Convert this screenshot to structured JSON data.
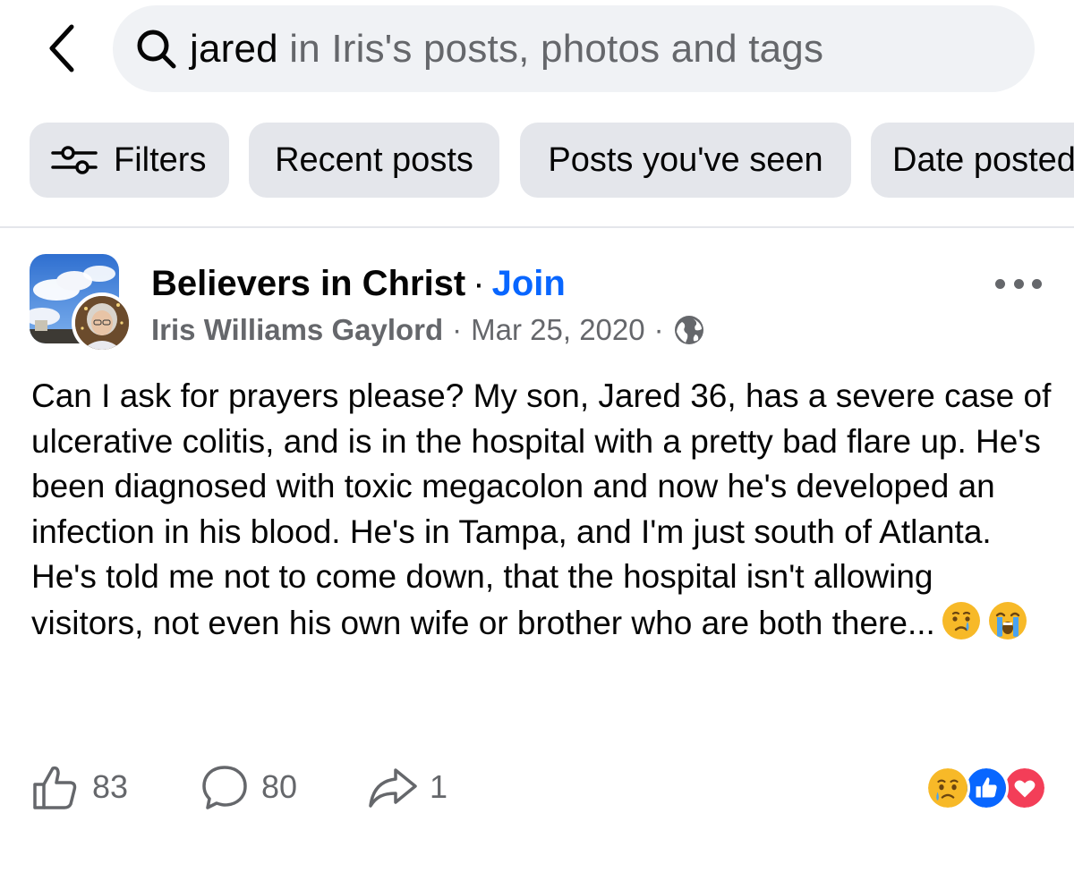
{
  "search": {
    "query": "jared",
    "scope": " in Iris's posts, photos and tags"
  },
  "chips": {
    "filters": "Filters",
    "recent": "Recent posts",
    "seen": "Posts you've seen",
    "date": "Date posted"
  },
  "post": {
    "group_name": "Believers in Christ",
    "separator": "·",
    "join_label": "Join",
    "author": "Iris Williams Gaylord",
    "date": "Mar 25, 2020",
    "privacy_icon": "globe-icon",
    "body": "Can I ask for prayers please?  My son, Jared 36, has a severe case of ulcerative colitis, and is in the hospital with a pretty bad flare up.  He's been diagnosed with toxic megacolon and now he's developed an infection in his blood.  He's in Tampa, and I'm just south of Atlanta.  He's told me not to come down, that the hospital isn't allowing visitors, not even his own wife or brother who are both there...",
    "body_emojis": [
      "crying-face-emoji",
      "loudly-crying-face-emoji"
    ],
    "likes": "83",
    "comments": "80",
    "shares": "1",
    "reactions": [
      "sad-reaction-icon",
      "like-reaction-icon",
      "love-reaction-icon"
    ]
  },
  "colors": {
    "link_blue": "#0866ff",
    "secondary_text": "#65676b",
    "chip_bg": "#e4e6eb",
    "search_bg": "#f0f2f5",
    "love_red": "#f33e58",
    "reaction_yellow": "#f7b928"
  }
}
